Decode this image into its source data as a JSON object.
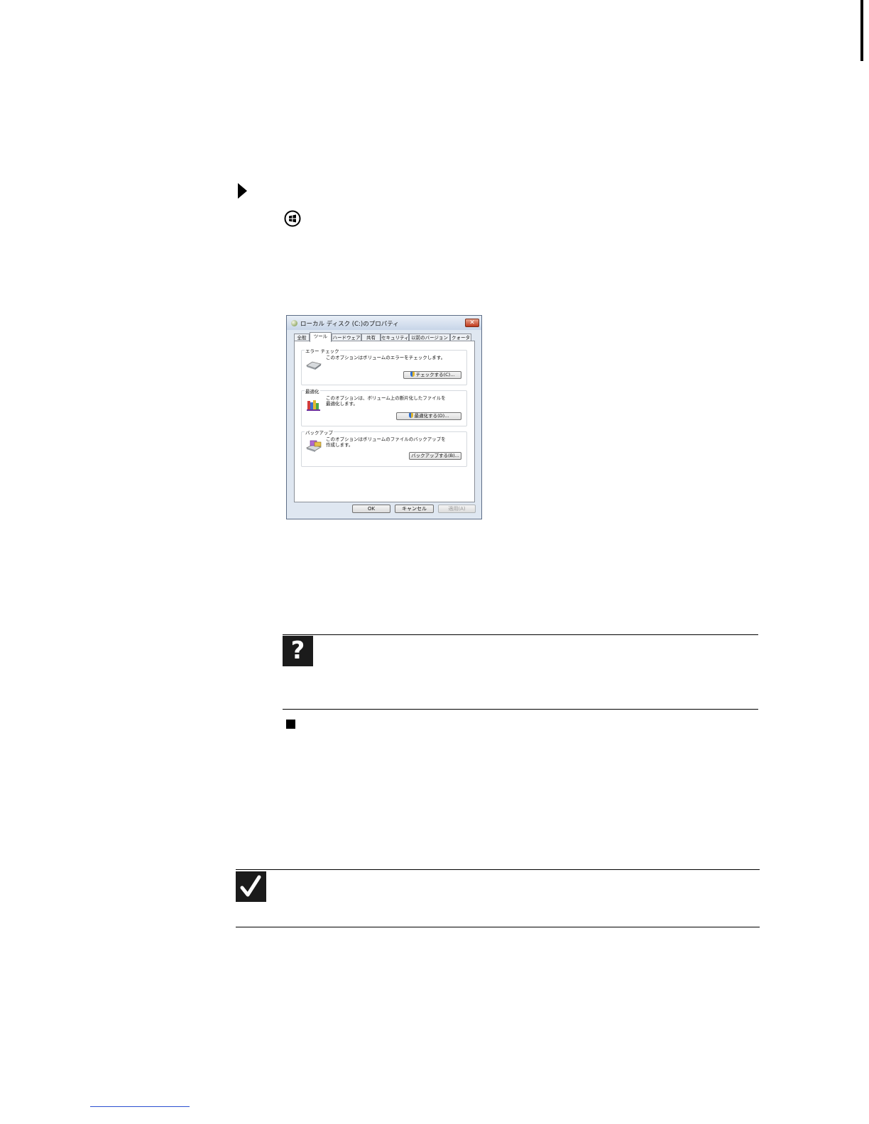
{
  "page": {
    "icons": {
      "step_marker": "play-triangle-icon",
      "windows_start": "windows-start-button-icon",
      "help": "question-mark-icon",
      "important": "check-mark-icon",
      "end_of_procedure": "black-square-icon"
    }
  },
  "dialog": {
    "title": "ローカル ディスク (C:)のプロパティ",
    "close_label": "✕",
    "tabs": [
      "全般",
      "ツール",
      "ハードウェア",
      "共有",
      "セキュリティ",
      "以前のバージョン",
      "クォータ"
    ],
    "active_tab": "ツール",
    "groups": [
      {
        "legend": "エラー チェック",
        "description": "このオプションはボリュームのエラーをチェックします。",
        "button": "チェックする(C)..."
      },
      {
        "legend": "最適化",
        "description": "このオプションは、ボリューム上の断片化したファイルを最適化します。",
        "button": "最適化する(D)..."
      },
      {
        "legend": "バックアップ",
        "description": "このオプションはボリュームのファイルのバックアップを作成します。",
        "button": "バックアップする(B)..."
      }
    ],
    "buttons": {
      "ok": "OK",
      "cancel": "キャンセル",
      "apply": "適用(A)"
    }
  }
}
